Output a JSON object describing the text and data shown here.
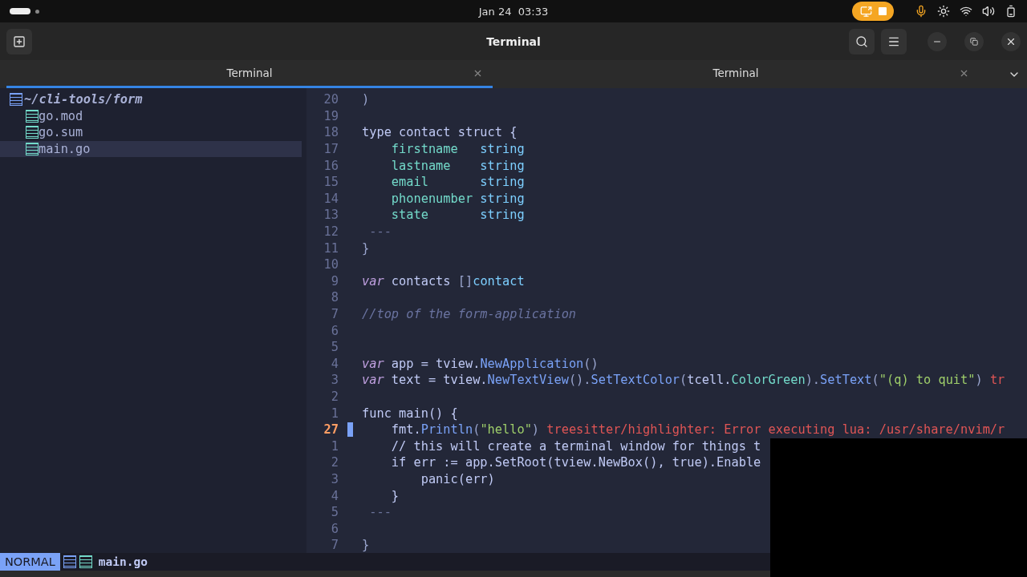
{
  "top_bar": {
    "date": "Jan 24",
    "time": "03:33"
  },
  "window": {
    "title": "Terminal"
  },
  "tabs": [
    {
      "label": "Terminal",
      "selected": true
    },
    {
      "label": "Terminal",
      "selected": false
    }
  ],
  "file_tree": {
    "root": "~/cli-tools/form",
    "items": [
      {
        "name": "go.mod",
        "selected": false
      },
      {
        "name": "go.sum",
        "selected": false
      },
      {
        "name": "main.go",
        "selected": true
      }
    ]
  },
  "code_lines": [
    {
      "number": "20",
      "current": false,
      "tokens": [
        {
          "kind": "punct",
          "text": ")"
        }
      ]
    },
    {
      "number": "19",
      "current": false
    },
    {
      "number": "18",
      "current": false,
      "tokens": [
        {
          "kind": "plain",
          "text": "type contact struct {"
        }
      ]
    },
    {
      "number": "17",
      "current": false,
      "tokens": [
        {
          "kind": "field",
          "text": "    firstname   "
        },
        {
          "kind": "type",
          "text": "string"
        }
      ]
    },
    {
      "number": "16",
      "current": false,
      "tokens": [
        {
          "kind": "field",
          "text": "    lastname    "
        },
        {
          "kind": "type",
          "text": "string"
        }
      ]
    },
    {
      "number": "15",
      "current": false,
      "tokens": [
        {
          "kind": "field",
          "text": "    email       "
        },
        {
          "kind": "type",
          "text": "string"
        }
      ]
    },
    {
      "number": "14",
      "current": false,
      "tokens": [
        {
          "kind": "field",
          "text": "    phonenumber "
        },
        {
          "kind": "type",
          "text": "string"
        }
      ]
    },
    {
      "number": "13",
      "current": false,
      "tokens": [
        {
          "kind": "field",
          "text": "    state       "
        },
        {
          "kind": "type",
          "text": "string"
        }
      ]
    },
    {
      "number": "12",
      "current": false,
      "tokens": [
        {
          "kind": "fold",
          "text": " ---"
        }
      ]
    },
    {
      "number": "11",
      "current": false,
      "tokens": [
        {
          "kind": "punct",
          "text": "}"
        }
      ]
    },
    {
      "number": "10",
      "current": false
    },
    {
      "number": "9",
      "current": false,
      "tokens": [
        {
          "kind": "keyword",
          "text": "var"
        },
        {
          "kind": "plain",
          "text": " contacts "
        },
        {
          "kind": "punct",
          "text": "[]"
        },
        {
          "kind": "type",
          "text": "contact"
        }
      ]
    },
    {
      "number": "8",
      "current": false
    },
    {
      "number": "7",
      "current": false,
      "tokens": [
        {
          "kind": "comment",
          "text": "//top of the form-application"
        }
      ]
    },
    {
      "number": "6",
      "current": false
    },
    {
      "number": "5",
      "current": false
    },
    {
      "number": "4",
      "current": false,
      "tokens": [
        {
          "kind": "keyword",
          "text": "var"
        },
        {
          "kind": "plain",
          "text": " app = tview."
        },
        {
          "kind": "func",
          "text": "NewApplication"
        },
        {
          "kind": "punct",
          "text": "()"
        }
      ]
    },
    {
      "number": "3",
      "current": false,
      "tokens": [
        {
          "kind": "keyword",
          "text": "var"
        },
        {
          "kind": "plain",
          "text": " text = tview."
        },
        {
          "kind": "func",
          "text": "NewTextView"
        },
        {
          "kind": "punct",
          "text": "()."
        },
        {
          "kind": "func",
          "text": "SetTextColor"
        },
        {
          "kind": "punct",
          "text": "("
        },
        {
          "kind": "plain",
          "text": "tcell."
        },
        {
          "kind": "field",
          "text": "ColorGreen"
        },
        {
          "kind": "punct",
          "text": ")."
        },
        {
          "kind": "func",
          "text": "SetText"
        },
        {
          "kind": "punct",
          "text": "("
        },
        {
          "kind": "string",
          "text": "\"(q) to quit\""
        },
        {
          "kind": "punct",
          "text": ") "
        },
        {
          "kind": "error",
          "text": "tr"
        }
      ]
    },
    {
      "number": "2",
      "current": false
    },
    {
      "number": "1",
      "current": false,
      "tokens": [
        {
          "kind": "plain",
          "text": "func main() {"
        }
      ]
    },
    {
      "number": "27",
      "current": true,
      "tokens": [
        {
          "kind": "plain",
          "text": "    fmt."
        },
        {
          "kind": "func",
          "text": "Println"
        },
        {
          "kind": "punct",
          "text": "("
        },
        {
          "kind": "string",
          "text": "\"hello\""
        },
        {
          "kind": "punct",
          "text": ") "
        },
        {
          "kind": "error",
          "text": "treesitter/highlighter: Error executing lua: /usr/share/nvim/r"
        }
      ]
    },
    {
      "number": "1",
      "current": false,
      "tokens": [
        {
          "kind": "plain",
          "text": "    // this will create a terminal window for things t"
        }
      ]
    },
    {
      "number": "2",
      "current": false,
      "tokens": [
        {
          "kind": "plain",
          "text": "    if err := app.SetRoot(tview.NewBox(), true).Enable"
        }
      ]
    },
    {
      "number": "3",
      "current": false,
      "tokens": [
        {
          "kind": "plain",
          "text": "        panic(err)"
        }
      ]
    },
    {
      "number": "4",
      "current": false,
      "tokens": [
        {
          "kind": "plain",
          "text": "    }"
        }
      ]
    },
    {
      "number": "5",
      "current": false,
      "tokens": [
        {
          "kind": "fold",
          "text": " ---"
        }
      ]
    },
    {
      "number": "6",
      "current": false
    },
    {
      "number": "7",
      "current": false,
      "tokens": [
        {
          "kind": "punct",
          "text": "}"
        }
      ]
    }
  ],
  "status_bar": {
    "mode": "NORMAL",
    "file": "main.go"
  }
}
